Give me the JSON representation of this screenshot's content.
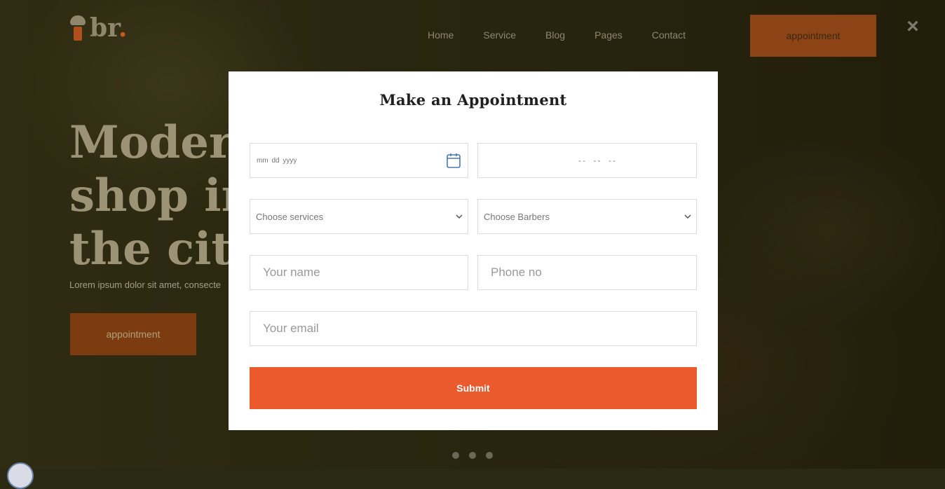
{
  "brand": {
    "logo_text": "br",
    "logo_dot": ".",
    "accent": "#ea5a2d"
  },
  "nav": {
    "items": [
      {
        "label": "Home"
      },
      {
        "label": "Service"
      },
      {
        "label": "Blog"
      },
      {
        "label": "Pages"
      },
      {
        "label": "Contact"
      }
    ],
    "appointment_label": "appointment",
    "close_icon": "×"
  },
  "hero": {
    "title_lines": [
      "Moder",
      "shop in",
      "the city"
    ],
    "subtitle": "Lorem ipsum dolor sit amet, consecte",
    "appointment_label": "appointment"
  },
  "modal": {
    "title": "Make an Appointment",
    "date_placeholder": "mm  dd  yyyy",
    "date_icon": "calendar-icon",
    "time_placeholder": "-- -- --",
    "service_select": "Choose services",
    "barber_select": "Choose Barbers",
    "name_placeholder": "Your name",
    "phone_placeholder": "Phone no",
    "email_placeholder": "Your email",
    "submit_label": "Submit"
  },
  "slider": {
    "dot_count": 3
  }
}
